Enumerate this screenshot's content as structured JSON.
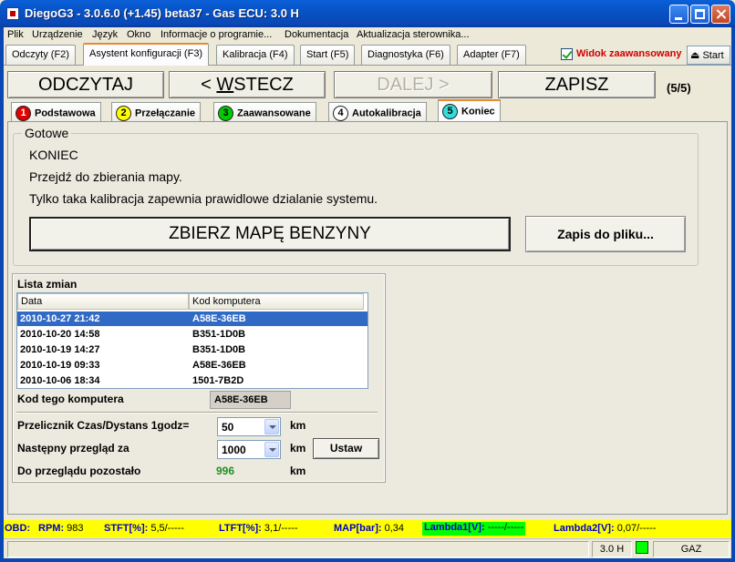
{
  "window": {
    "title": "DiegoG3 - 3.0.6.0 (+1.45) beta37 - Gas ECU: 3.0 H"
  },
  "menu": [
    "Plik",
    "Urządzenie",
    "Język",
    "Okno",
    "Informacje o programie...",
    "Dokumentacja",
    "Aktualizacja sterownika..."
  ],
  "main_tabs": [
    "Odczyty (F2)",
    "Asystent konfiguracji (F3)",
    "Kalibracja (F4)",
    "Start (F5)",
    "Diagnostyka (F6)",
    "Adapter (F7)"
  ],
  "advanced_view": {
    "label": "Widok zaawansowany",
    "checked": true
  },
  "start_button": "Start",
  "actions": {
    "read": "ODCZYTAJ",
    "back_prefix": "< ",
    "back_underlined": "W",
    "back_rest": "STECZ",
    "next": "DALEJ  >",
    "save": "ZAPISZ",
    "step": "(5/5)"
  },
  "sub_tabs": [
    {
      "num": "1",
      "label": "Podstawowa",
      "color": "#e00000"
    },
    {
      "num": "2",
      "label": "Przełączanie",
      "color": "#ffff00"
    },
    {
      "num": "3",
      "label": "Zaawansowane",
      "color": "#00cc00"
    },
    {
      "num": "4",
      "label": "Autokalibracja",
      "color": "#ffffff"
    },
    {
      "num": "5",
      "label": "Koniec",
      "color": "#33dddd"
    }
  ],
  "ready": {
    "title": "Gotowe",
    "line1": "KONIEC",
    "line2": "Przejdź do zbierania mapy.",
    "line3": "Tylko taka kalibracja zapewnia prawidlowe dzialanie systemu.",
    "collect_button": "ZBIERZ MAPĘ BENZYNY",
    "save_file_button": "Zapis do pliku..."
  },
  "change_list": {
    "title": "Lista zmian",
    "columns": [
      "Data",
      "Kod komputera"
    ],
    "rows": [
      [
        "2010-10-27 21:42",
        "A58E-36EB"
      ],
      [
        "2010-10-20 14:58",
        "B351-1D0B"
      ],
      [
        "2010-10-19 14:27",
        "B351-1D0B"
      ],
      [
        "2010-10-19 09:33",
        "A58E-36EB"
      ],
      [
        "2010-10-06 18:34",
        "1501-7B2D"
      ]
    ],
    "selected_index": 0
  },
  "computer_code": {
    "label": "Kod tego komputera",
    "value": "A58E-36EB"
  },
  "service": {
    "converter_label": "Przelicznik Czas/Dystans 1godz=",
    "converter_value": "50",
    "next_label": "Następny przegląd za",
    "next_value": "1000",
    "remaining_label": "Do przeglądu pozostało",
    "remaining_value": "996",
    "unit": "km",
    "set_button": "Ustaw"
  },
  "obd": {
    "prefix": "OBD:",
    "rpm_label": "RPM:",
    "rpm_value": "983",
    "stft_label": "STFT[%]:",
    "stft_value": "5,5/-----",
    "ltft_label": "LTFT[%]:",
    "ltft_value": "3,1/-----",
    "map_label": "MAP[bar]:",
    "map_value": "0,34",
    "lambda1_label": "Lambda1[V]:",
    "lambda1_value": "-----/-----",
    "lambda2_label": "Lambda2[V]:",
    "lambda2_value": "0,07/-----"
  },
  "status": {
    "ecu": "3.0 H",
    "fuel": "GAZ"
  }
}
